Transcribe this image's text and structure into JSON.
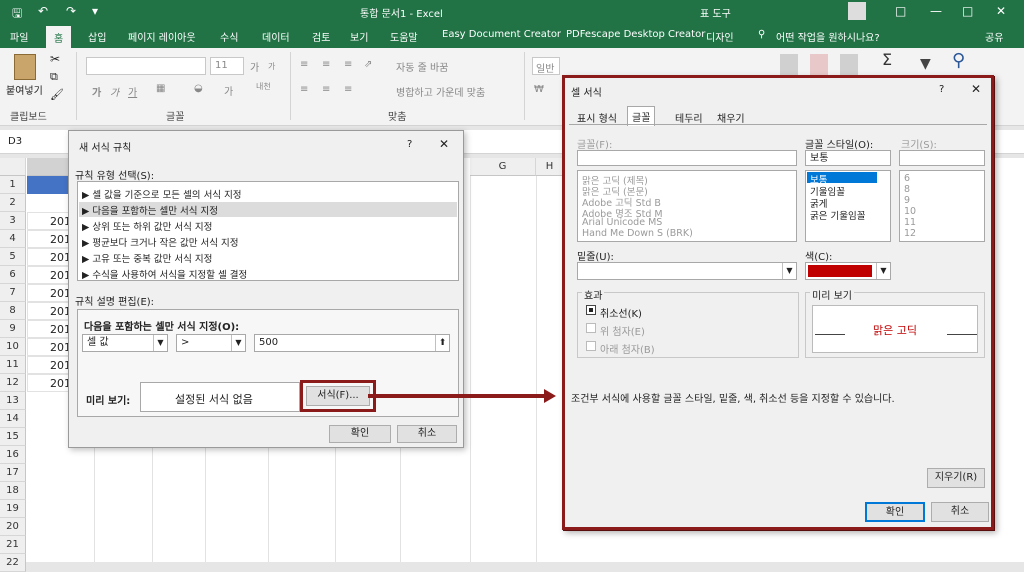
{
  "titlebar": {
    "title": "통합 문서1  -  Excel",
    "tool": "표 도구"
  },
  "ribbon_tabs": [
    "파일",
    "홈",
    "삽입",
    "페이지 레이아웃",
    "수식",
    "데이터",
    "검토",
    "보기",
    "도움말",
    "Easy Document Creator",
    "PDFescape Desktop Creator",
    "디자인"
  ],
  "tell_me": "어떤 작업을 원하시나요?",
  "share": "공유",
  "ribbon": {
    "paste": "붙여넣기",
    "clipboard_group": "클립보드",
    "font_group": "글꼴",
    "align_group": "맞춤",
    "font_size": "11",
    "wrap_text": "자동 줄 바꿈",
    "merge_center": "병합하고 가운데 맞춤",
    "number_format": "일반",
    "bold": "가",
    "italic": "가",
    "underline": "가",
    "grow": "가",
    "shrink": "가"
  },
  "namebox": "D3",
  "columns": [
    "G",
    "H"
  ],
  "rows": [
    "1",
    "2",
    "3",
    "4",
    "5",
    "6",
    "7",
    "8",
    "9",
    "10",
    "11",
    "12",
    "13",
    "14",
    "15",
    "16",
    "17",
    "18",
    "19",
    "20",
    "21",
    "22"
  ],
  "cells_a": [
    "201",
    "201",
    "201",
    "201",
    "201",
    "201",
    "201",
    "201",
    "201",
    "201"
  ],
  "dialog1": {
    "title": "새 서식 규칙",
    "help": "?",
    "rule_type_label": "규칙 유형 선택(S):",
    "rule_types": [
      "▶ 셀 값을 기준으로 모든 셀의 서식 지정",
      "▶ 다음을 포함하는 셀만 서식 지정",
      "▶ 상위 또는 하위 값만 서식 지정",
      "▶ 평균보다 크거나 작은 값만 서식 지정",
      "▶ 고유 또는 중복 값만 서식 지정",
      "▶ 수식을 사용하여 서식을 지정할 셀 결정"
    ],
    "edit_label": "규칙 설명 편집(E):",
    "condition_heading": "다음을 포함하는 셀만 서식 지정(O):",
    "cond_type": "셀 값",
    "operator": ">",
    "value": "500",
    "preview_label": "미리 보기:",
    "preview_text": "설정된 서식 없음",
    "format_button": "서식(F)...",
    "ok": "확인",
    "cancel": "취소"
  },
  "dialog2": {
    "title": "셀 서식",
    "help": "?",
    "tabs": [
      "표시 형식",
      "글꼴",
      "테두리",
      "채우기"
    ],
    "font_label": "글꼴(F):",
    "fonts": [
      "맑은 고딕 (제목)",
      "맑은 고딕 (본문)",
      "Adobe 고딕 Std B",
      "Adobe 명조 Std M",
      "Arial Unicode MS",
      "Hand Me Down S (BRK)"
    ],
    "style_label": "글꼴 스타일(O):",
    "style_value": "보통",
    "styles": [
      "보통",
      "기울임꼴",
      "굵게",
      "굵은 기울임꼴"
    ],
    "size_label": "크기(S):",
    "sizes": [
      "6",
      "8",
      "9",
      "10",
      "11",
      "12"
    ],
    "underline_label": "밑줄(U):",
    "color_label": "색(C):",
    "color_value": "#c00000",
    "effects_label": "효과",
    "effects": [
      "취소선(K)",
      "위 첨자(E)",
      "아래 첨자(B)"
    ],
    "preview_label": "미리 보기",
    "preview_text": "맑은 고딕",
    "note": "조건부 서식에 사용할 글꼴 스타일, 밑줄, 색, 취소선 등을 지정할 수 있습니다.",
    "clear": "지우기(R)",
    "ok": "확인",
    "cancel": "취소"
  },
  "accent": "#217346",
  "highlight": "#8b1a1a"
}
